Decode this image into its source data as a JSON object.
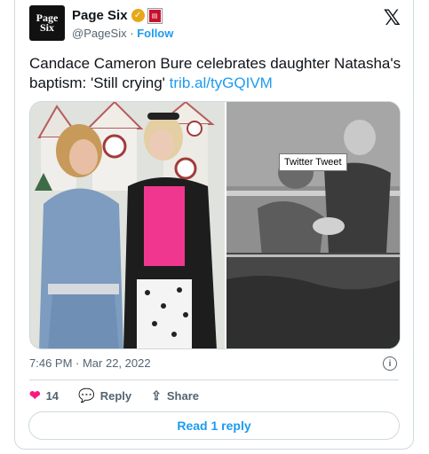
{
  "author": {
    "avatar_lines": [
      "Page",
      "Six"
    ],
    "name": "Page Six",
    "handle": "@PageSix",
    "follow_label": "Follow"
  },
  "icons": {
    "verified": "verified-badge-icon",
    "affiliate": "affiliate-badge-icon",
    "logo": "x-logo-icon",
    "info": "info-icon",
    "like": "heart-icon",
    "reply": "reply-bubble-icon",
    "share": "share-icon"
  },
  "tweet": {
    "text": "Candace Cameron Bure celebrates daughter Natasha's baptism: 'Still crying' ",
    "link": "trib.al/tyGQIVM"
  },
  "media": {
    "tooltip": "Twitter Tweet"
  },
  "meta": {
    "time": "7:46 PM · Mar 22, 2022",
    "info_glyph": "i"
  },
  "actions": {
    "likes": "14",
    "reply_label": "Reply",
    "share_label": "Share"
  },
  "footer": {
    "read_replies": "Read 1 reply"
  },
  "colors": {
    "accent": "#1d9bf0",
    "like": "#f91880",
    "border": "#cfd9de",
    "muted": "#536471"
  }
}
